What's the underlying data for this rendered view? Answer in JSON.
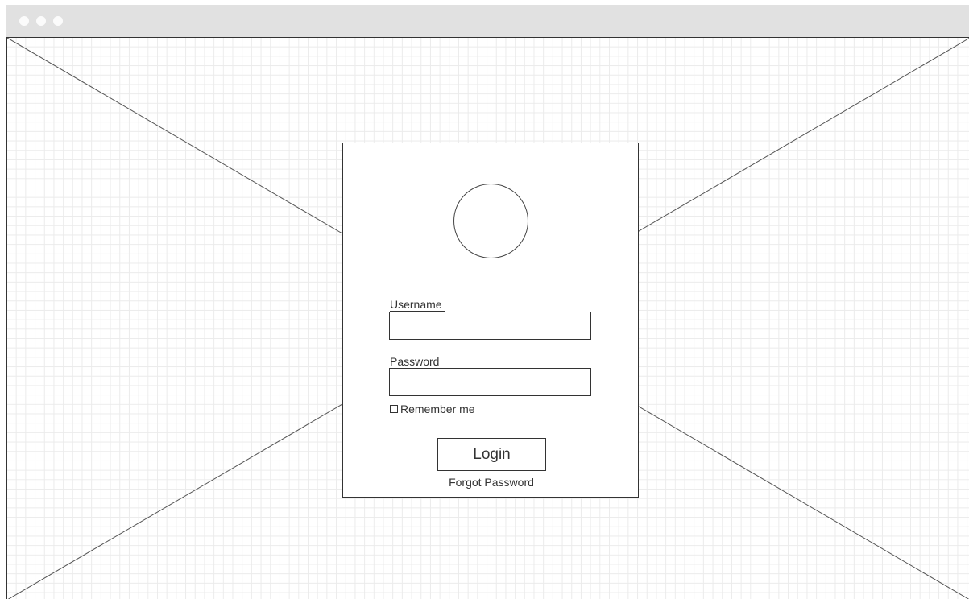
{
  "chrome": {
    "window_controls": [
      "window-dot",
      "window-dot",
      "window-dot"
    ]
  },
  "login": {
    "username_label": "Username",
    "username_value": "",
    "password_label": "Password",
    "password_value": "",
    "remember_label": "Remember me",
    "remember_checked": false,
    "login_label": "Login",
    "forgot_label": "Forgot Password",
    "avatar_icon": "avatar-placeholder-circle"
  },
  "colors": {
    "stroke": "#333333",
    "grid": "#ebebeb",
    "chrome_bar": "#e1e1e1",
    "background": "#ffffff"
  }
}
